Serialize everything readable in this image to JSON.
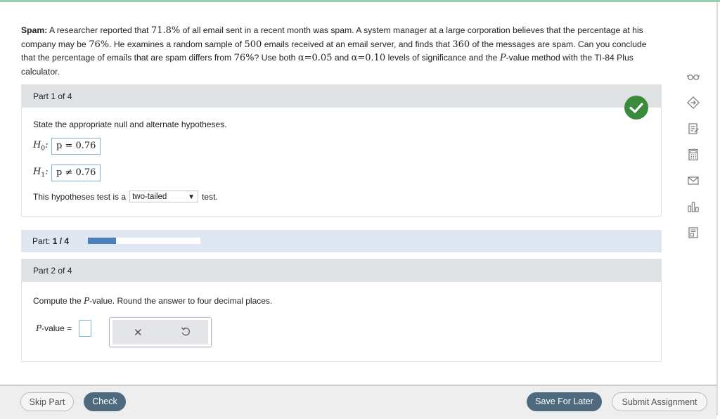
{
  "question": {
    "lead": "Spam:",
    "s1": " A researcher reported that ",
    "pct1": "71.8%",
    "s2": " of all email sent in a recent month was spam. A system manager at a large corporation believes that the percentage at his company may be ",
    "pct2": "76%",
    "s3": ". He examines a random sample of ",
    "n": "500",
    "s4": " emails received at an email server, and finds that ",
    "x": "360",
    "s5": " of the messages are spam. Can you conclude that the percentage of emails that are spam differs from ",
    "pct3": "76%",
    "s6": "? Use both ",
    "a1": "α=0.05",
    "s7": " and ",
    "a2": "α=0.10",
    "s8": " levels of significance and the ",
    "p": "P",
    "s9": "-value method with the TI-84 Plus calculator."
  },
  "part1": {
    "header": "Part 1 of 4",
    "instruction": "State the appropriate null and alternate hypotheses.",
    "h0_label": "H",
    "h0_sub": "0",
    "h0_value": "p = 0.76",
    "h1_label": "H",
    "h1_sub": "1",
    "h1_value": "p ≠ 0.76",
    "colon": ":",
    "test_pre": "This hypotheses test is a",
    "test_type": "two-tailed",
    "test_post": "test."
  },
  "progress": {
    "label": "Part:",
    "current": "1 / 4",
    "fraction": 0.25,
    "color": "#4d7fb8"
  },
  "part2": {
    "header": "Part 2 of 4",
    "instruction_pre": "Compute the ",
    "instruction_p": "P",
    "instruction_post": "-value. Round the answer to four decimal places.",
    "pvalue_p": "P",
    "pvalue_label": "-value =",
    "clear_symbol": "✕"
  },
  "sidebar": {
    "icons": [
      "glasses-icon",
      "hint-icon",
      "notes-icon",
      "calculator-icon",
      "mail-icon",
      "chart-icon",
      "worksheet-icon"
    ]
  },
  "footer": {
    "skip": "Skip Part",
    "check": "Check",
    "save": "Save For Later",
    "submit": "Submit Assignment"
  },
  "colors": {
    "success": "#3b8a3e",
    "accent": "#4e6a7e"
  }
}
